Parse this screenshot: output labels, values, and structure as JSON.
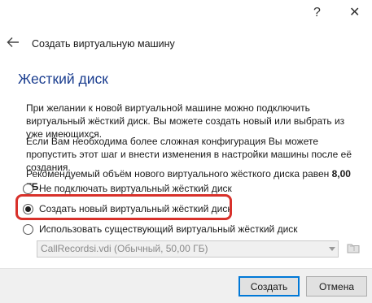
{
  "window": {
    "help_label": "?",
    "close_label": "✕"
  },
  "header": {
    "back_icon": "arrow-left-icon",
    "title": "Создать виртуальную машину"
  },
  "page": {
    "title": "Жесткий диск",
    "paragraph1": "При желании к новой виртуальной машине можно подключить виртуальный жёсткий диск. Вы можете создать новый или выбрать из уже имеющихся.",
    "paragraph2": "Если Вам необходима более сложная конфигурация Вы можете пропустить этот шаг и внести изменения в настройки машины после её создания.",
    "recommended_prefix": "Рекомендуемый объём нового виртуального жёсткого диска равен ",
    "recommended_size": "8,00 ГБ",
    "recommended_suffix": "."
  },
  "options": [
    {
      "label": "Не подключать виртуальный жёсткий диск",
      "checked": false
    },
    {
      "label": "Создать новый виртуальный жёсткий диск",
      "checked": true
    },
    {
      "label": "Использовать существующий виртуальный жёсткий диск",
      "checked": false
    }
  ],
  "existing_disk": {
    "selected": "CallRecordsi.vdi (Обычный, 50,00 ГБ)",
    "enabled": false
  },
  "buttons": {
    "create": "Создать",
    "cancel": "Отмена"
  },
  "colors": {
    "title_blue": "#1a3d8f",
    "highlight_red": "#d8312b",
    "focus_blue": "#0078d7"
  }
}
